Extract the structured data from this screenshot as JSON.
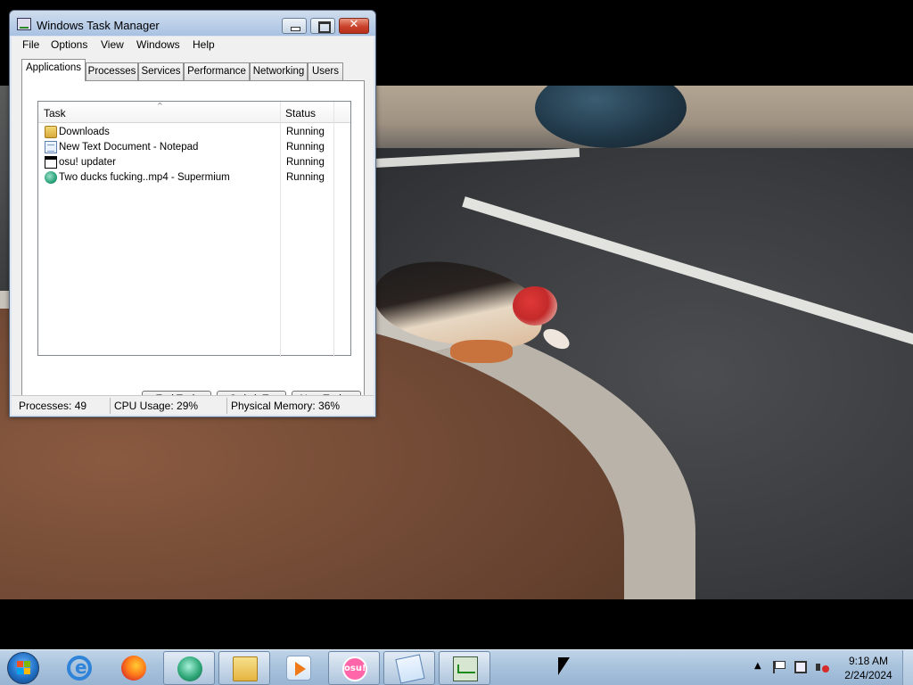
{
  "window": {
    "title": "Windows Task Manager",
    "close_glyph": "✕"
  },
  "menu": [
    "File",
    "Options",
    "View",
    "Windows",
    "Help"
  ],
  "tabs": [
    "Applications",
    "Processes",
    "Services",
    "Performance",
    "Networking",
    "Users"
  ],
  "active_tab": "Applications",
  "list": {
    "columns": [
      "Task",
      "Status"
    ],
    "sort_indicator": "^",
    "rows": [
      {
        "task": "Downloads",
        "status": "Running",
        "icon": "folder-icon"
      },
      {
        "task": "New Text Document - Notepad",
        "status": "Running",
        "icon": "notepad-icon"
      },
      {
        "task": "osu! updater",
        "status": "Running",
        "icon": "window-icon"
      },
      {
        "task": "Two ducks fucking..mp4 - Supermium",
        "status": "Running",
        "icon": "supermium-icon"
      }
    ]
  },
  "buttons": {
    "end_task": "End Task",
    "switch_to": "Switch To",
    "new_task": "New Task..."
  },
  "statusbar": {
    "processes": "Processes: 49",
    "cpu": "CPU Usage: 29%",
    "memory": "Physical Memory: 36%"
  },
  "taskbar": {
    "items": [
      {
        "name": "internet-explorer-icon",
        "state": "pinned"
      },
      {
        "name": "firefox-icon",
        "state": "pinned"
      },
      {
        "name": "supermium-icon",
        "state": "running"
      },
      {
        "name": "windows-explorer-icon",
        "state": "running"
      },
      {
        "name": "windows-media-player-icon",
        "state": "pinned"
      },
      {
        "name": "osu-icon",
        "state": "running"
      },
      {
        "name": "notepad-icon",
        "state": "running"
      },
      {
        "name": "task-manager-icon",
        "state": "running"
      }
    ],
    "osu_label": "osu!",
    "tray_arrow": "▲",
    "clock_time": "9:18 AM",
    "clock_date": "2/24/2024"
  }
}
